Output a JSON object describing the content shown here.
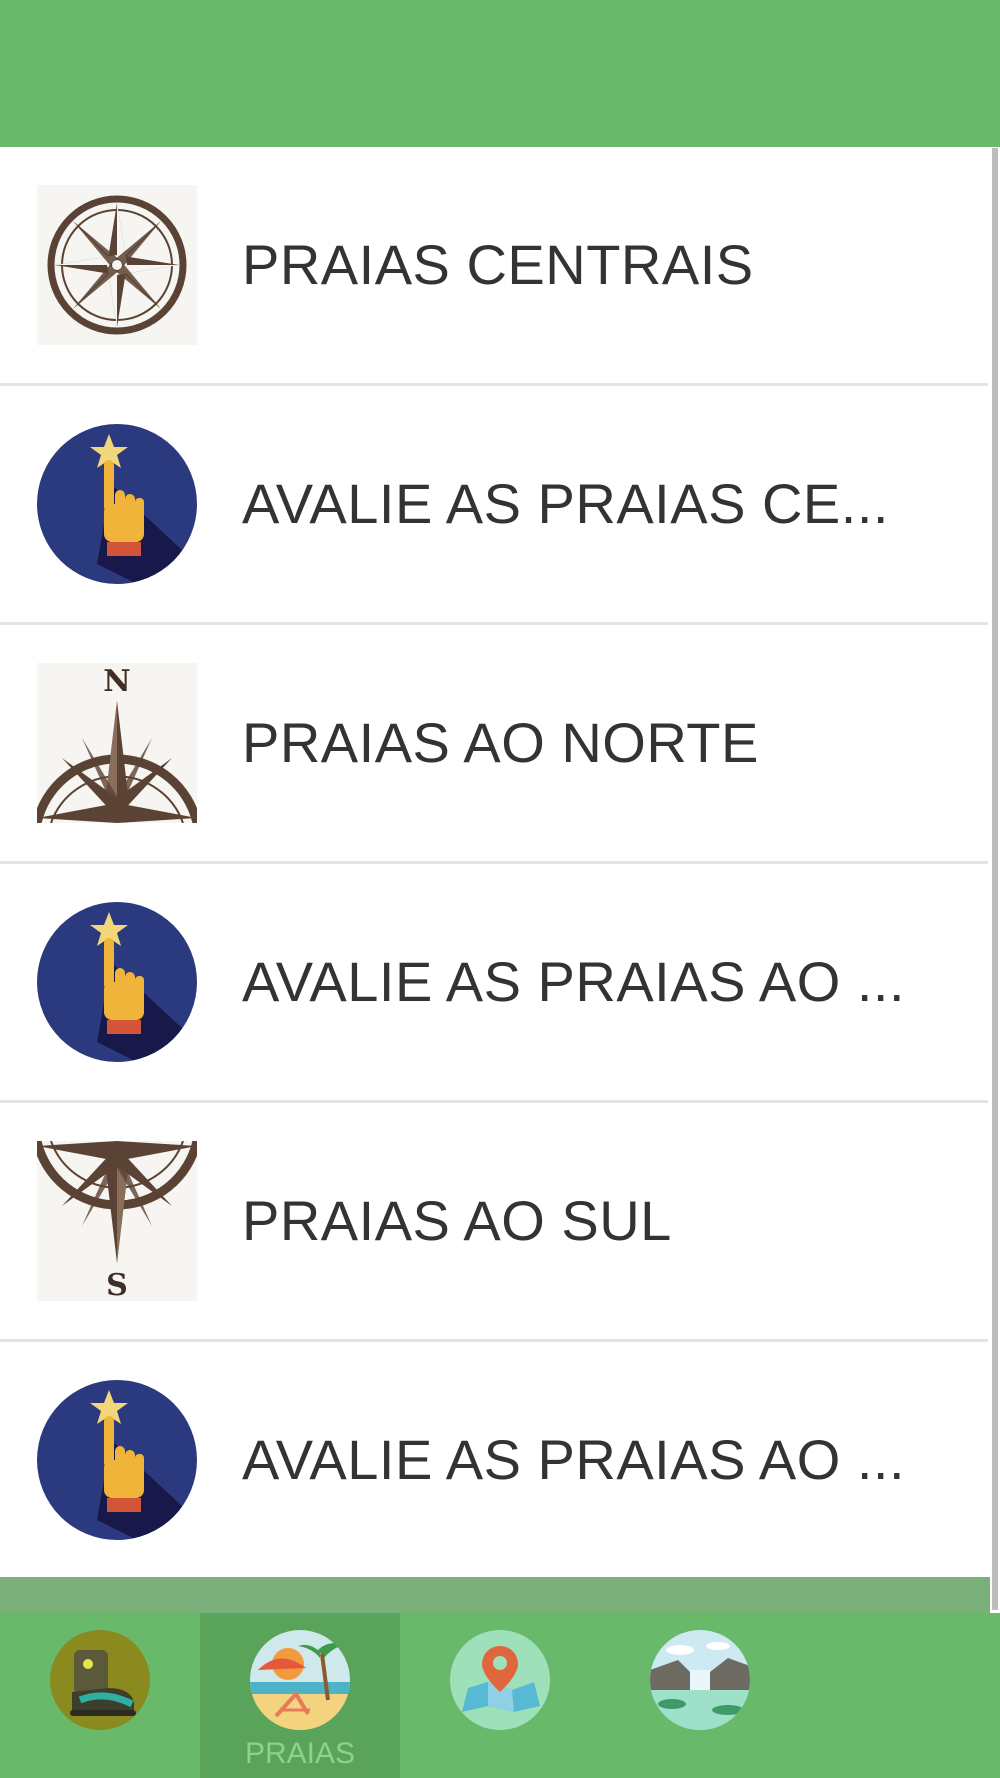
{
  "colors": {
    "header": "#69b96a",
    "tabbar": "#69b96a",
    "active_tab": "#5aa35b",
    "text": "#333333",
    "compass_brown": "#5a4334",
    "rating_circle": "#2b3a7e"
  },
  "list": {
    "items": [
      {
        "label": "PRAIAS CENTRAIS",
        "icon": "compass-rose-icon"
      },
      {
        "label": "AVALIE AS PRAIAS CE...",
        "icon": "rate-star-hand-icon"
      },
      {
        "label": "PRAIAS AO NORTE",
        "icon": "compass-north-icon",
        "letter": "N"
      },
      {
        "label": "AVALIE AS PRAIAS AO ...",
        "icon": "rate-star-hand-icon"
      },
      {
        "label": "PRAIAS AO SUL",
        "icon": "compass-south-icon",
        "letter": "S"
      },
      {
        "label": "AVALIE AS PRAIAS AO ...",
        "icon": "rate-star-hand-icon"
      }
    ]
  },
  "tabbar": {
    "tabs": [
      {
        "label": "",
        "icon": "hiking-boot-icon",
        "active": false
      },
      {
        "label": "PRAIAS",
        "icon": "beach-icon",
        "active": true
      },
      {
        "label": "",
        "icon": "map-pin-icon",
        "active": false
      },
      {
        "label": "",
        "icon": "waterfall-landscape-icon",
        "active": false
      }
    ]
  }
}
